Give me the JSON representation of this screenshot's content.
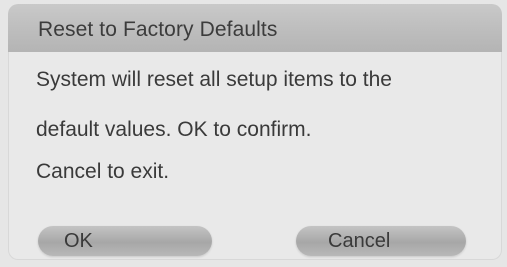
{
  "dialog": {
    "title": "Reset to Factory Defaults",
    "message_lines": [
      "System will reset all setup items to the",
      "default values. OK to confirm.",
      "Cancel to exit."
    ],
    "buttons": {
      "ok_label": "OK",
      "cancel_label": "Cancel"
    }
  },
  "colors": {
    "background": "#e9e9e9",
    "title_bar": "#bcbcbc",
    "button": "#a7a7a7",
    "text": "#3a3a3a"
  }
}
